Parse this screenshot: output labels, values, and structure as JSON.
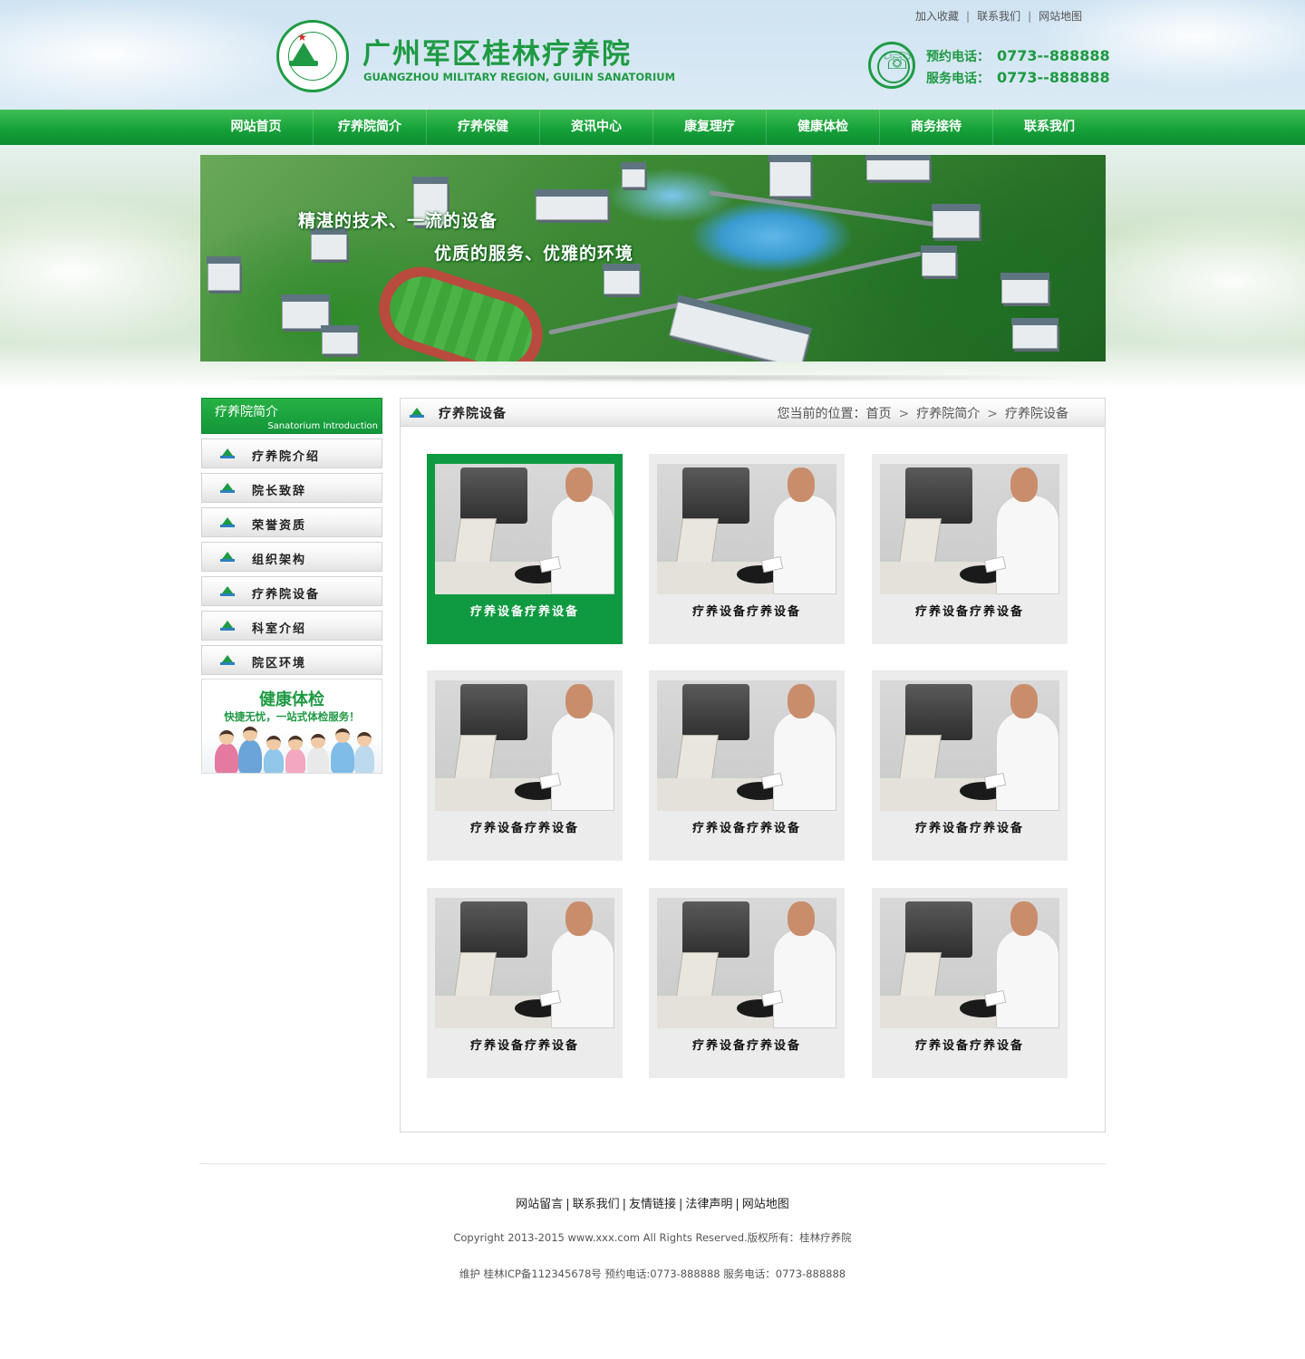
{
  "header": {
    "title": "广州军区桂林疗养院",
    "subtitle": "GUANGZHOU MILITARY REGION, GUILIN SANATORIUM",
    "top_links": [
      "加入收藏",
      "联系我们",
      "网站地图"
    ],
    "phone_rows": [
      {
        "label": "预约电话：",
        "number": "0773--888888"
      },
      {
        "label": "服务电话：",
        "number": "0773--888888"
      }
    ]
  },
  "nav": [
    "网站首页",
    "疗养院简介",
    "疗养保健",
    "资讯中心",
    "康复理疗",
    "健康体检",
    "商务接待",
    "联系我们"
  ],
  "banner": {
    "slogan_1": "精湛的技术、一流的设备",
    "slogan_2": "优质的服务、优雅的环境"
  },
  "sidebar": {
    "title": "疗养院简介",
    "title_en": "Sanatorium Introduction",
    "items": [
      "疗养院介绍",
      "院长致辞",
      "荣誉资质",
      "组织架构",
      "疗养院设备",
      "科室介绍",
      "院区环境"
    ],
    "promo": {
      "title": "健康体检",
      "tagline": "快捷无忧，一站式体检服务！"
    }
  },
  "main": {
    "title": "疗养院设备",
    "breadcrumb_prefix": "您当前的位置：",
    "breadcrumb": [
      "首页",
      "疗养院简介",
      "疗养院设备"
    ],
    "items": [
      {
        "caption": "疗养设备疗养设备",
        "active": true
      },
      {
        "caption": "疗养设备疗养设备",
        "active": false
      },
      {
        "caption": "疗养设备疗养设备",
        "active": false
      },
      {
        "caption": "疗养设备疗养设备",
        "active": false
      },
      {
        "caption": "疗养设备疗养设备",
        "active": false
      },
      {
        "caption": "疗养设备疗养设备",
        "active": false
      },
      {
        "caption": "疗养设备疗养设备",
        "active": false
      },
      {
        "caption": "疗养设备疗养设备",
        "active": false
      },
      {
        "caption": "疗养设备疗养设备",
        "active": false
      }
    ]
  },
  "footer": {
    "links": [
      "网站留言",
      "联系我们",
      "友情链接",
      "法律声明",
      "网站地图"
    ],
    "copyright": "Copyright 2013-2015 www.xxx.com All Rights Reserved.版权所有：桂林疗养院",
    "icp": "维护 桂林ICP备112345678号 预约电话:0773-888888 服务电话：0773-888888"
  },
  "colors": {
    "brand_green": "#1e9a43",
    "active_card": "#0f9a41",
    "nav_green": "#16a23a"
  }
}
